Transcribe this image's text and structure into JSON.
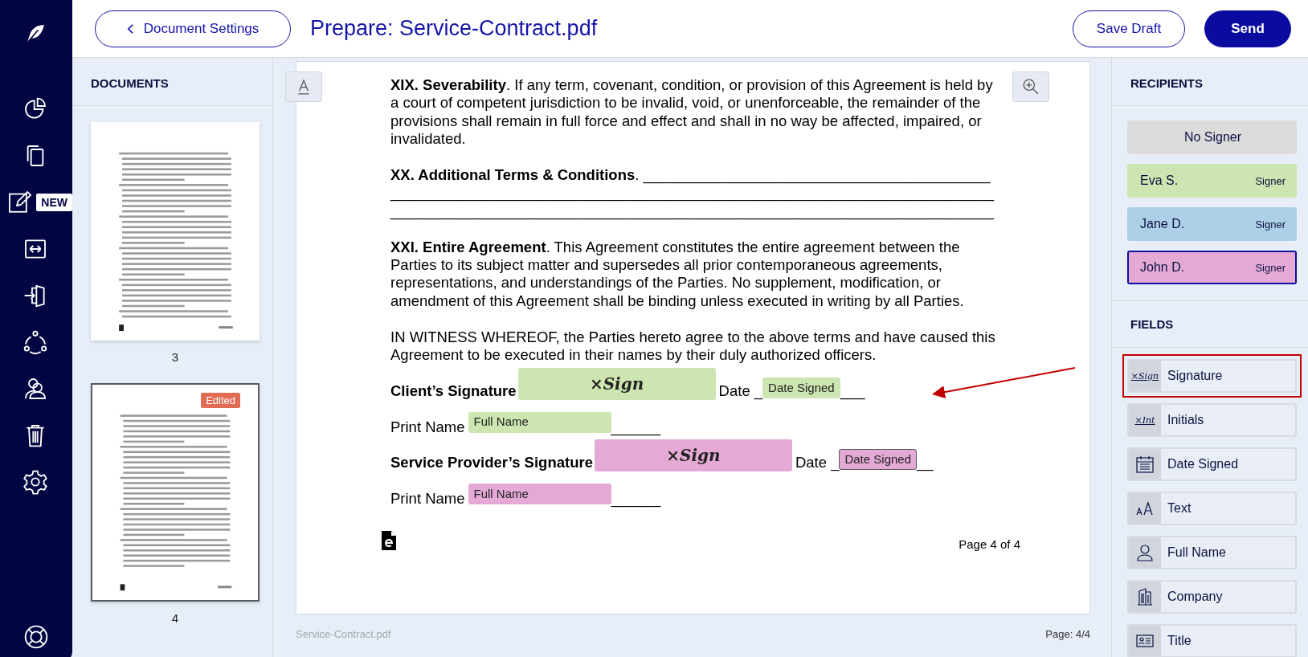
{
  "nav": {
    "items": [
      {
        "kind": "chart"
      },
      {
        "kind": "copy"
      },
      {
        "kind": "edit",
        "badge": "NEW"
      },
      {
        "kind": "transfer"
      },
      {
        "kind": "enter"
      },
      {
        "kind": "network"
      },
      {
        "kind": "users"
      },
      {
        "kind": "trash"
      },
      {
        "kind": "settings"
      }
    ],
    "help": {
      "kind": "help"
    }
  },
  "header": {
    "back_button": "Document Settings",
    "title": "Prepare: Service-Contract.pdf",
    "save_button": "Save Draft",
    "send_button": "Send"
  },
  "documents": {
    "heading": "DOCUMENTS",
    "pages": [
      {
        "label": "3",
        "selected": false
      },
      {
        "label": "4",
        "selected": true,
        "badge": "Edited"
      }
    ]
  },
  "page": {
    "paragraphs": [
      {
        "kind": "text",
        "text": "**XIX. Severability**. If any term, covenant, condition, or provision of this Agreement is held by a court of competent jurisdiction to be invalid, void, or unenforceable, the remainder of the provisions shall remain in full force and effect and shall in no way be affected, impaired, or invalidated."
      },
      {
        "kind": "lines",
        "lines": [
          "**XX. Additional Terms & Conditions**. __________________________________________",
          "_________________________________________________________________________",
          "_________________________________________________________________________"
        ]
      },
      {
        "kind": "text",
        "text": "**XXI. Entire Agreement**. This Agreement constitutes the entire agreement between the Parties to its subject matter and supersedes all prior contemporaneous agreements, representations, and understandings of the Parties. No supplement, modification, or amendment of this Agreement shall be binding unless executed in writing by all Parties."
      },
      {
        "kind": "text",
        "text": "IN WITNESS WHEREOF, the Parties hereto agree to the above terms and have caused this Agreement to be executed in their names by their duly authorized officers."
      }
    ],
    "sign_lines": [
      [
        {
          "kind": "text",
          "text": "Client’s Signature",
          "bold": true
        },
        {
          "kind": "signature",
          "text": "×Sign",
          "color": "#cde5b0",
          "selected": false
        },
        {
          "kind": "text",
          "text": "Date _",
          "bold": false
        },
        {
          "kind": "date",
          "text": "Date Signed",
          "color": "#cde5b0",
          "selected": false
        },
        {
          "kind": "text",
          "text": "___",
          "bold": false
        }
      ],
      [
        {
          "kind": "text",
          "text": "Print Name",
          "bold": false
        },
        {
          "kind": "name",
          "text": "Full Name",
          "color": "#cde5b0",
          "selected": false
        },
        {
          "kind": "text",
          "text": "______",
          "bold": false
        }
      ],
      [
        {
          "kind": "text",
          "text": "Service Provider’s Signature",
          "bold": true
        },
        {
          "kind": "signature",
          "text": "×Sign",
          "color": "#e4aad5",
          "selected": false
        },
        {
          "kind": "text",
          "text": "Date _",
          "bold": false
        },
        {
          "kind": "date",
          "text": "Date Signed",
          "color": "#e4aad5",
          "selected": true
        },
        {
          "kind": "text",
          "text": "__",
          "bold": false
        }
      ],
      [
        {
          "kind": "text",
          "text": "Print Name",
          "bold": false
        },
        {
          "kind": "name",
          "text": "Full Name",
          "color": "#e4aad5",
          "selected": false
        },
        {
          "kind": "text",
          "text": "______",
          "bold": false
        }
      ]
    ],
    "page_number": "Page 4 of 4"
  },
  "footer": {
    "file_name": "Service-Contract.pdf",
    "page": "Page: 4/4"
  },
  "recipients": {
    "heading": "RECIPIENTS",
    "items": [
      {
        "name": "No Signer",
        "color": "#dcdcdc",
        "selected": false
      },
      {
        "name": "Eva S.",
        "role": "Signer",
        "color": "#cde5b0",
        "selected": false
      },
      {
        "name": "Jane D.",
        "role": "Signer",
        "color": "#aed0e6",
        "selected": false
      },
      {
        "name": "John D.",
        "role": "Signer",
        "color": "#e4aad5",
        "selected": true
      }
    ]
  },
  "fields": {
    "heading": "FIELDS",
    "items": [
      {
        "kind": "signature",
        "label": "Signature",
        "icon_text": "×Sign",
        "highlighted": true
      },
      {
        "kind": "initials",
        "label": "Initials",
        "icon_text": "×Int",
        "highlighted": false
      },
      {
        "kind": "date",
        "label": "Date Signed",
        "highlighted": false
      },
      {
        "kind": "text",
        "label": "Text",
        "highlighted": false
      },
      {
        "kind": "name",
        "label": "Full Name",
        "highlighted": false
      },
      {
        "kind": "company",
        "label": "Company",
        "highlighted": false
      },
      {
        "kind": "title",
        "label": "Title",
        "highlighted": false
      }
    ]
  }
}
